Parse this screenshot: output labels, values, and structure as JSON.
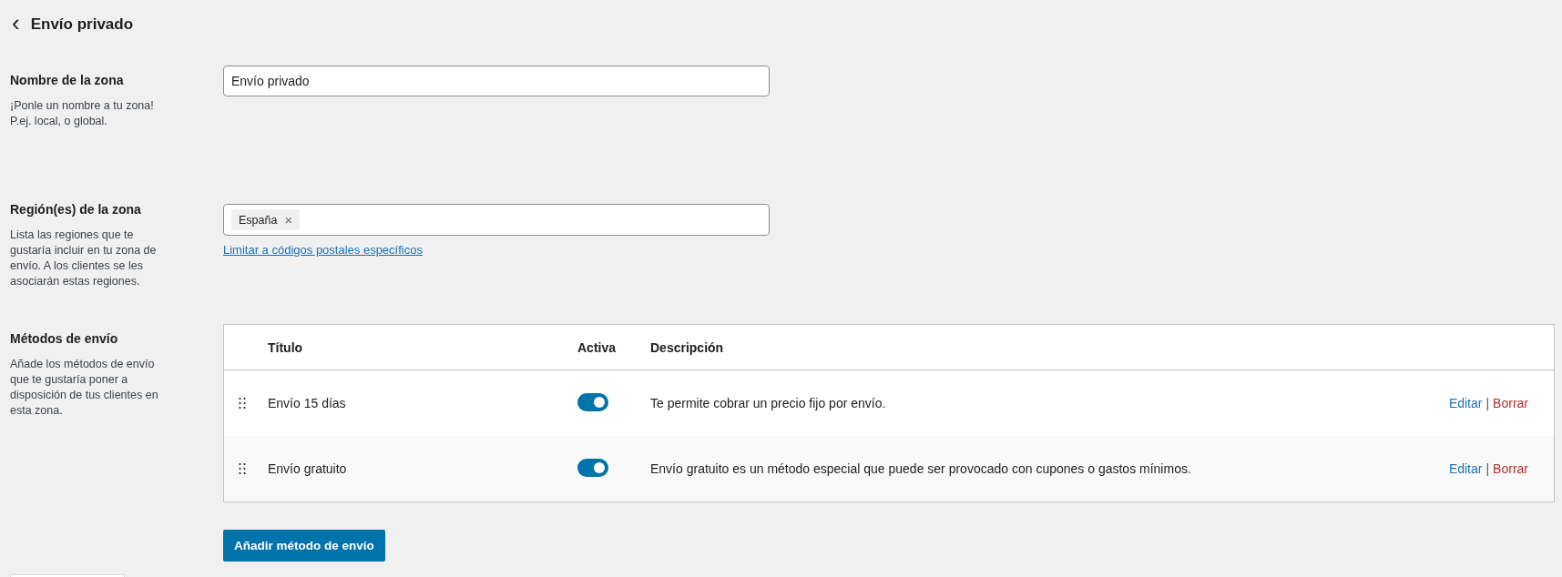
{
  "header": {
    "back": "‹",
    "title": "Envío privado"
  },
  "zone_name": {
    "label": "Nombre de la zona",
    "help": "¡Ponle un nombre a tu zona! P.ej. local, o global.",
    "value": "Envío privado"
  },
  "zone_regions": {
    "label": "Región(es) de la zona",
    "help": "Lista las regiones que te gustaría incluir en tu zona de envío. A los clientes se les asociarán estas regiones.",
    "tags": [
      {
        "label": "España",
        "remove": "×"
      }
    ],
    "link": "Limitar a códigos postales específicos"
  },
  "methods": {
    "label": "Métodos de envío",
    "help": "Añade los métodos de envío que te gustaría poner a disposición de tus clientes en esta zona.",
    "columns": [
      "Título",
      "Activa",
      "Descripción"
    ],
    "rows": [
      {
        "title": "Envío 15 días",
        "on": true,
        "description": "Te permite cobrar un precio fijo por envío.",
        "edit": "Editar",
        "separator": "|",
        "delete": "Borrar"
      },
      {
        "title": "Envío gratuito",
        "on": true,
        "description": "Envío gratuito es un método especial que puede ser provocado con cupones o gastos mínimos.",
        "edit": "Editar",
        "separator": "|",
        "delete": "Borrar"
      }
    ],
    "add_button": "Añadir método de envío"
  }
}
